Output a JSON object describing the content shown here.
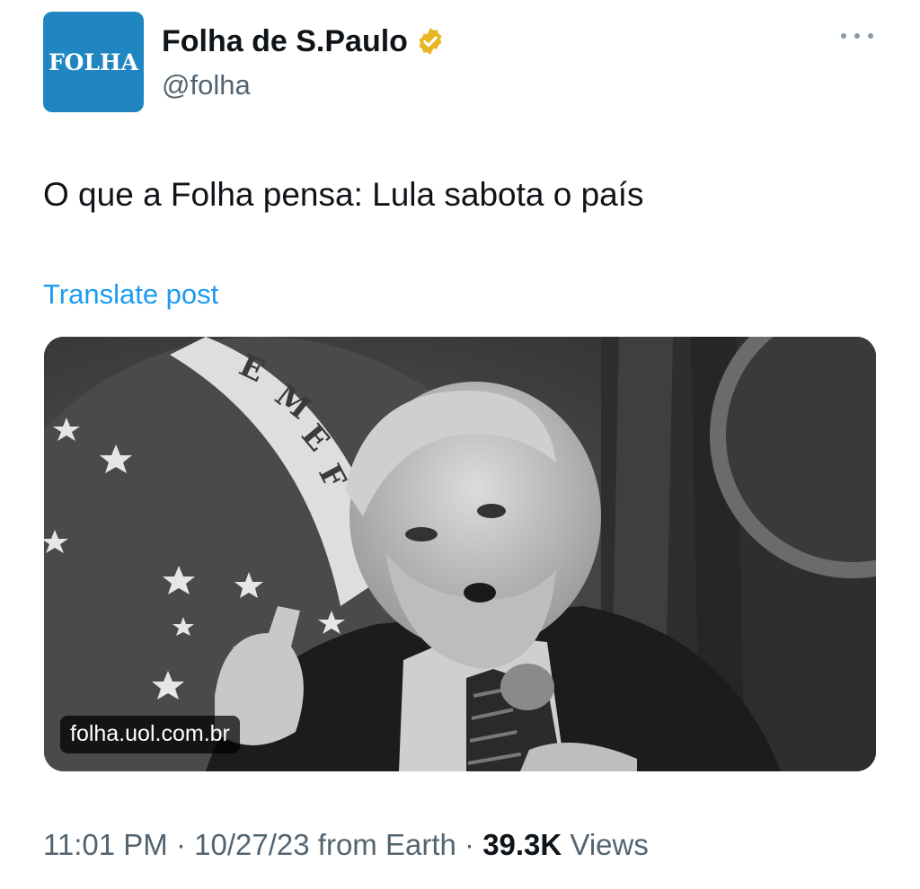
{
  "author": {
    "avatar_text": "FOLHA",
    "display_name": "Folha de S.Paulo",
    "handle": "@folha",
    "verified_icon": "verified-badge-icon",
    "colors": {
      "avatar_bg": "#1f86c1",
      "verified": "#e8b623"
    }
  },
  "tweet": {
    "text": "O que a Folha pensa: Lula sabota o país",
    "translate_label": "Translate post"
  },
  "media": {
    "description_icon": "photo-icon",
    "link_domain": "folha.uol.com.br",
    "banner_letters": "EMEF"
  },
  "meta": {
    "time": "11:01 PM",
    "separator": "·",
    "date": "10/27/23",
    "source": "from Earth",
    "views_count": "39.3K",
    "views_label": "Views"
  },
  "colors": {
    "link": "#1d9bf0",
    "secondary_text": "#536471",
    "primary_text": "#0f1419"
  }
}
